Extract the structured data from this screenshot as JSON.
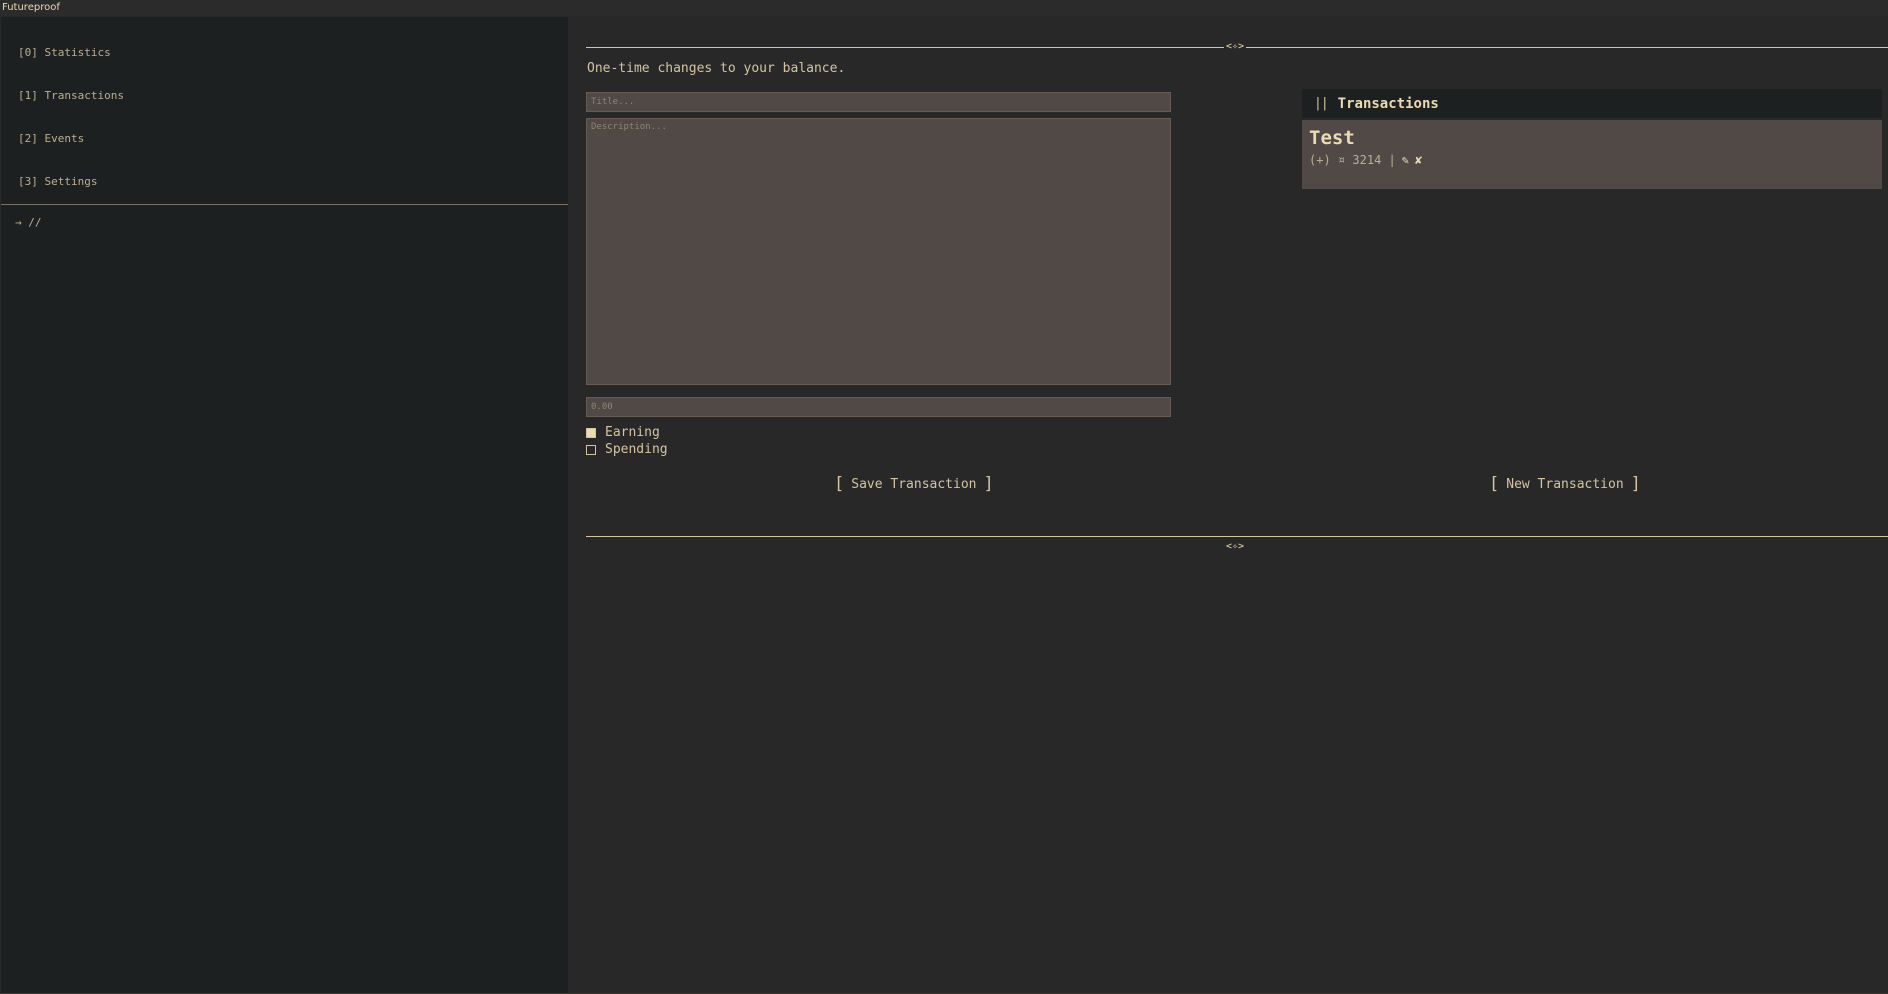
{
  "window": {
    "title": "Futureproof"
  },
  "sidebar": {
    "items": [
      {
        "label": "[0] Statistics"
      },
      {
        "label": "[1] Transactions"
      },
      {
        "label": "[2] Events"
      },
      {
        "label": "[3] Settings"
      }
    ],
    "prompt": "→ //"
  },
  "main": {
    "ornament": "<✧>",
    "intro": "One-time changes to your balance.",
    "form": {
      "title_placeholder": "Title...",
      "description_placeholder": "Description...",
      "amount_placeholder": "0.00",
      "earning_label": "Earning",
      "earning_checked": true,
      "spending_label": "Spending",
      "spending_checked": false,
      "save_label": "Save Transaction"
    },
    "new_label": "New Transaction",
    "panel": {
      "header": "Transactions",
      "items": [
        {
          "title": "Test",
          "sign": "(+)",
          "currency": "¤",
          "amount": "3214",
          "sep": "|",
          "edit_icon": "pencil-icon",
          "delete_icon": "x-icon"
        }
      ]
    }
  },
  "colors": {
    "background": "#282828",
    "sidebar": "#1d2021",
    "field": "#504945",
    "accent": "#ebdbb2",
    "text": "#d5c4a1"
  }
}
